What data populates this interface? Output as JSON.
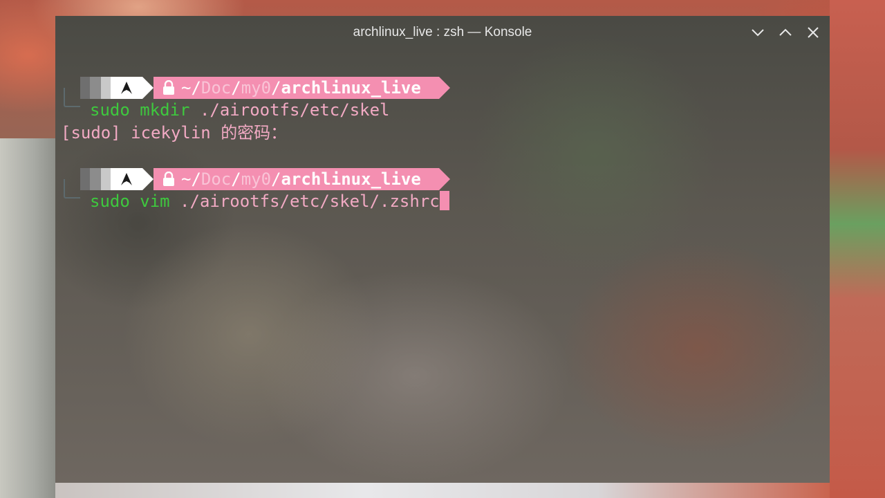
{
  "window": {
    "title": "archlinux_live : zsh — Konsole",
    "buttons": [
      "minimize",
      "maximize",
      "close"
    ]
  },
  "prompts": [
    {
      "icon": "arch-linux-icon",
      "lock_icon": "lock-icon",
      "path_home": "~/",
      "path_dim_1": "Doc",
      "sep_1": "/",
      "path_dim_2": "my0",
      "sep_2": "/",
      "path_current": "archlinux_live",
      "command": "sudo mkdir",
      "args": " ./airootfs/etc/skel"
    },
    {
      "icon": "arch-linux-icon",
      "lock_icon": "lock-icon",
      "path_home": "~/",
      "path_dim_1": "Doc",
      "sep_1": "/",
      "path_dim_2": "my0",
      "sep_2": "/",
      "path_current": "archlinux_live",
      "command": "sudo vim",
      "args": " ./airootfs/etc/skel/.zshrc"
    }
  ],
  "output": {
    "sudo_prompt": "[sudo] icekylin 的密码："
  },
  "colors": {
    "prompt_pink": "#f48fb1",
    "command_green": "#3ec93e",
    "arg_pink": "#f2aac4"
  }
}
